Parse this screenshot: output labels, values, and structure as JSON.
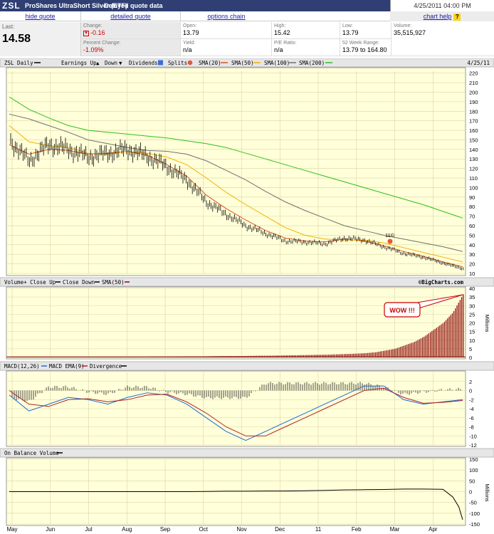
{
  "header": {
    "symbol": "ZSL",
    "name": "ProShares UltraShort Silver (ETF)",
    "delayed": "Delayed quote data",
    "timestamp": "4/25/2011 04:00 PM"
  },
  "links": {
    "hide_quote": "hide quote",
    "detailed_quote": "detailed quote",
    "options_chain": "options chain",
    "chart_help": "chart help",
    "help_icon": "?"
  },
  "quote": {
    "last_label": "Last:",
    "last": "14.58",
    "change_label": "Change:",
    "change": "-0.16",
    "pct_label": "Percent Change:",
    "pct": "-1.09%",
    "open_label": "Open:",
    "open": "13.79",
    "yield_label": "Yield:",
    "yield": "n/a",
    "high_label": "High:",
    "high": "15.42",
    "pe_label": "P/E Ratio:",
    "pe": "n/a",
    "low_label": "Low:",
    "low": "13.79",
    "range_label": "52 Week Range:",
    "range": "13.79 to 164.80",
    "volume_label": "Volume:",
    "volume": "35,515,927"
  },
  "colors": {
    "panel_bg": "#ffffd9",
    "sma20": "#d9531e",
    "sma50": "#f2b200",
    "sma100": "#707070",
    "sma200": "#2ec01c",
    "macd": "#1f6bd6",
    "ema": "#b22222",
    "volume_bar": "#8b0000"
  },
  "chart_data": [
    {
      "type": "line",
      "title": "ZSL Daily",
      "date_label": "4/25/11",
      "legend": [
        "Earnings Up",
        "Down",
        "Dividends",
        "Splits",
        "SMA(20)",
        "SMA(50)",
        "SMA(100)",
        "SMA(200)"
      ],
      "x": [
        "May",
        "May",
        "Jun",
        "Jun",
        "Jul",
        "Jul",
        "Aug",
        "Aug",
        "Sep",
        "Sep",
        "Oct",
        "Oct",
        "Nov",
        "Nov",
        "Dec",
        "Dec",
        "Jan",
        "Jan",
        "Feb",
        "Feb",
        "Mar",
        "Mar",
        "Apr",
        "Apr"
      ],
      "x_labels": [
        "May",
        "Jun",
        "Jul",
        "Aug",
        "Sep",
        "Oct",
        "Nov",
        "Dec",
        "11",
        "Feb",
        "Mar",
        "Apr"
      ],
      "series": [
        {
          "name": "ZSL",
          "values": [
            150,
            128,
            145,
            140,
            132,
            136,
            140,
            133,
            122,
            108,
            85,
            72,
            60,
            52,
            44,
            43,
            41,
            47,
            45,
            38,
            31,
            27,
            21,
            15
          ]
        },
        {
          "name": "SMA(20)",
          "values": [
            145,
            135,
            140,
            139,
            135,
            136,
            138,
            134,
            124,
            112,
            92,
            78,
            66,
            55,
            47,
            44,
            43,
            46,
            44,
            39,
            33,
            28,
            22,
            17
          ]
        },
        {
          "name": "SMA(50)",
          "values": [
            165,
            148,
            144,
            142,
            136,
            135,
            138,
            136,
            132,
            124,
            110,
            95,
            82,
            70,
            58,
            50,
            46,
            45,
            45,
            42,
            37,
            32,
            27,
            22
          ]
        },
        {
          "name": "SMA(100)",
          "values": [
            177,
            172,
            165,
            158,
            150,
            146,
            142,
            139,
            138,
            135,
            128,
            118,
            108,
            96,
            85,
            76,
            68,
            60,
            55,
            50,
            46,
            42,
            38,
            33
          ]
        },
        {
          "name": "SMA(200)",
          "values": [
            195,
            182,
            173,
            165,
            160,
            158,
            156,
            154,
            152,
            149,
            146,
            142,
            136,
            130,
            124,
            118,
            112,
            106,
            100,
            94,
            88,
            82,
            75,
            68
          ]
        }
      ],
      "annotation": "11©",
      "yticks": [
        10,
        20,
        30,
        40,
        50,
        60,
        70,
        80,
        90,
        100,
        110,
        120,
        130,
        140,
        150,
        160,
        170,
        180,
        190,
        200,
        210,
        220
      ],
      "ylim": [
        10,
        222
      ]
    },
    {
      "type": "bar",
      "title": "Volume+ Close Up",
      "legend": [
        "Close Up",
        "Close Down",
        "SMA(50)"
      ],
      "source": "©BigCharts.com",
      "ylabel": "Millions",
      "annotation": "WOW !!!",
      "ylim": [
        0,
        40
      ],
      "yticks": [
        0,
        5,
        10,
        15,
        20,
        25,
        30,
        35,
        40
      ],
      "values": [
        0.2,
        0.2,
        0.2,
        0.2,
        0.2,
        0.2,
        0.2,
        0.2,
        0.2,
        0.2,
        0.3,
        0.3,
        0.3,
        0.4,
        0.4,
        0.5,
        0.5,
        0.5,
        0.6,
        0.6,
        0.6,
        0.7,
        0.8,
        0.8,
        0.8,
        0.9,
        1.0,
        1.0,
        1.1,
        1.2,
        1.3,
        1.4,
        1.5,
        1.6,
        1.8,
        2.0,
        2.2,
        2.5,
        3,
        4,
        5,
        7,
        9,
        12,
        16,
        20,
        26,
        36
      ]
    },
    {
      "type": "line",
      "title": "MACD(12,26)",
      "legend": [
        "MACD EMA(9)",
        "Divergence"
      ],
      "ylim": [
        -12,
        4
      ],
      "yticks": [
        2,
        0,
        -2,
        -4,
        -6,
        -8,
        -10,
        -12
      ],
      "series": [
        {
          "name": "MACD(12,26)",
          "values": [
            -1,
            -4.5,
            -3,
            -1.5,
            -2,
            -3,
            -1.5,
            -0.5,
            -1,
            -3,
            -6,
            -9,
            -11,
            -9,
            -7,
            -5,
            -3,
            -1,
            1,
            1,
            -2,
            -3,
            -2.5,
            -2
          ]
        },
        {
          "name": "MACD EMA(9)",
          "values": [
            0,
            -3,
            -3.5,
            -2,
            -1.8,
            -2.5,
            -2,
            -1,
            -0.8,
            -2.5,
            -5,
            -8,
            -10,
            -10,
            -8,
            -6,
            -4,
            -2,
            0,
            0.5,
            -1.5,
            -2.8,
            -2.6,
            -2.2
          ]
        }
      ]
    },
    {
      "type": "line",
      "title": "On Balance Volume",
      "ylabel": "Millions",
      "ylim": [
        -150,
        150
      ],
      "yticks": [
        150,
        100,
        50,
        0,
        -50,
        -100,
        -150
      ],
      "values": [
        0,
        0,
        0,
        0,
        0,
        0,
        0,
        0,
        0,
        0,
        1,
        2,
        2,
        3,
        3,
        4,
        6,
        8,
        9,
        10,
        12,
        12,
        11,
        -130
      ]
    }
  ]
}
